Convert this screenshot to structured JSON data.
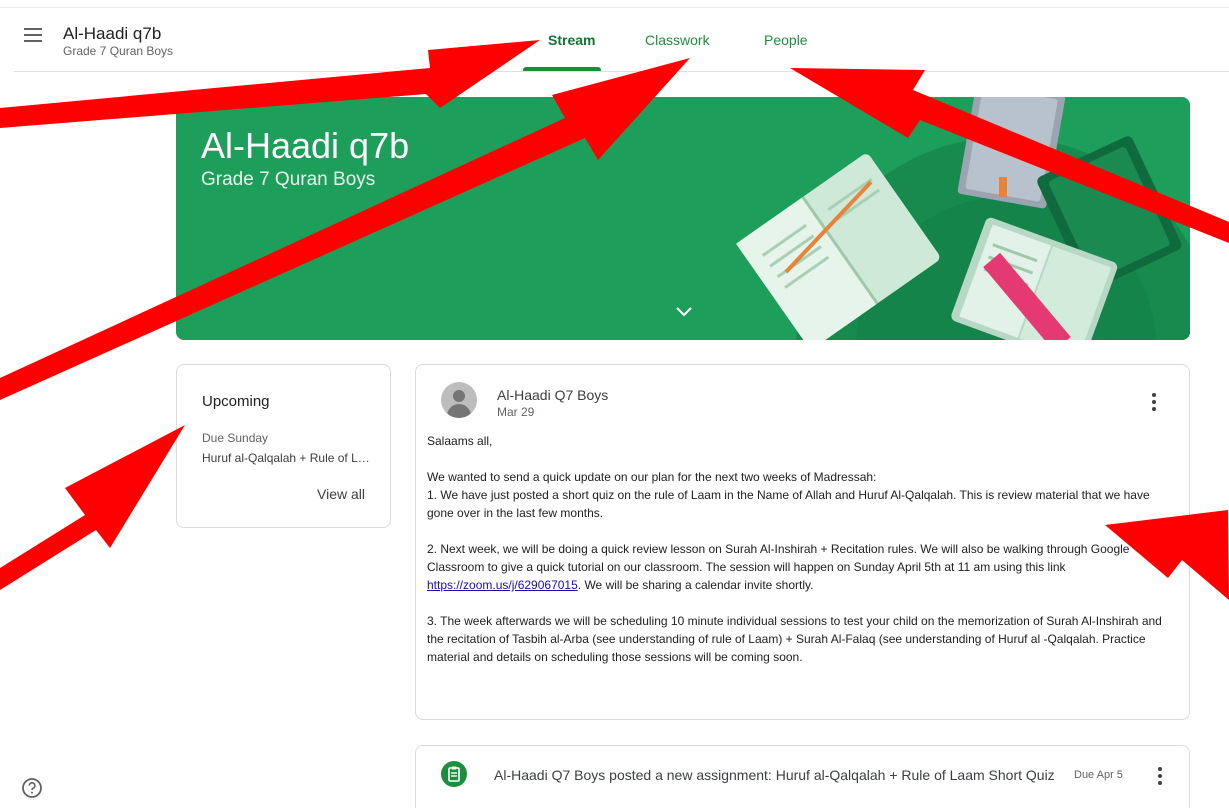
{
  "header": {
    "class_title": "Al-Haadi q7b",
    "class_subtitle": "Grade 7 Quran Boys",
    "tabs": [
      {
        "label": "Stream",
        "active": true
      },
      {
        "label": "Classwork",
        "active": false
      },
      {
        "label": "People",
        "active": false
      }
    ],
    "menu_icon": "hamburger-menu-icon"
  },
  "banner": {
    "title": "Al-Haadi q7b",
    "subtitle": "Grade 7 Quran Boys",
    "color": "#1e9e5b",
    "chevron_icon": "chevron-down-icon"
  },
  "upcoming": {
    "title": "Upcoming",
    "due_label": "Due Sunday",
    "item": "Huruf al-Qalqalah + Rule of Laam Short Quiz",
    "view_all": "View all"
  },
  "post": {
    "author": "Al-Haadi Q7 Boys",
    "date": "Mar 29",
    "greeting": "Salaams all,",
    "para1": "We wanted to send a quick update on our plan for the next two weeks of Madressah:",
    "para2": "1. We have just posted a short quiz on the rule of Laam in the Name of Allah and Huruf Al-Qalqalah. This is review material that we have gone over in the last few months.",
    "para3_before_link": "2. Next week, we will be doing a quick review lesson on Surah Al-Inshirah + Recitation rules. We will also be walking through Google Classroom to give a quick tutorial on our classroom. The session will happen on Sunday April 5th at 11 am using this link ",
    "link": "https://zoom.us/j/629067015",
    "para3_after_link": ". We will be sharing a calendar invite shortly.",
    "para4": "3. The week afterwards we will be scheduling 10 minute individual sessions to test your child on the memorization of Surah Al-Inshirah and the recitation of Tasbih al-Arba (see understanding of rule of Laam) + Surah Al-Falaq (see understanding of Huruf al -Qalqalah. Practice material and details on scheduling those sessions will be coming soon."
  },
  "assignment": {
    "text": "Al-Haadi Q7 Boys posted a new assignment: Huruf al-Qalqalah + Rule of Laam Short Quiz",
    "due": "Due Apr 5",
    "icon": "assignment-icon"
  },
  "colors": {
    "accent": "#1e8e3e",
    "annotation_arrow": "#ff0000"
  }
}
